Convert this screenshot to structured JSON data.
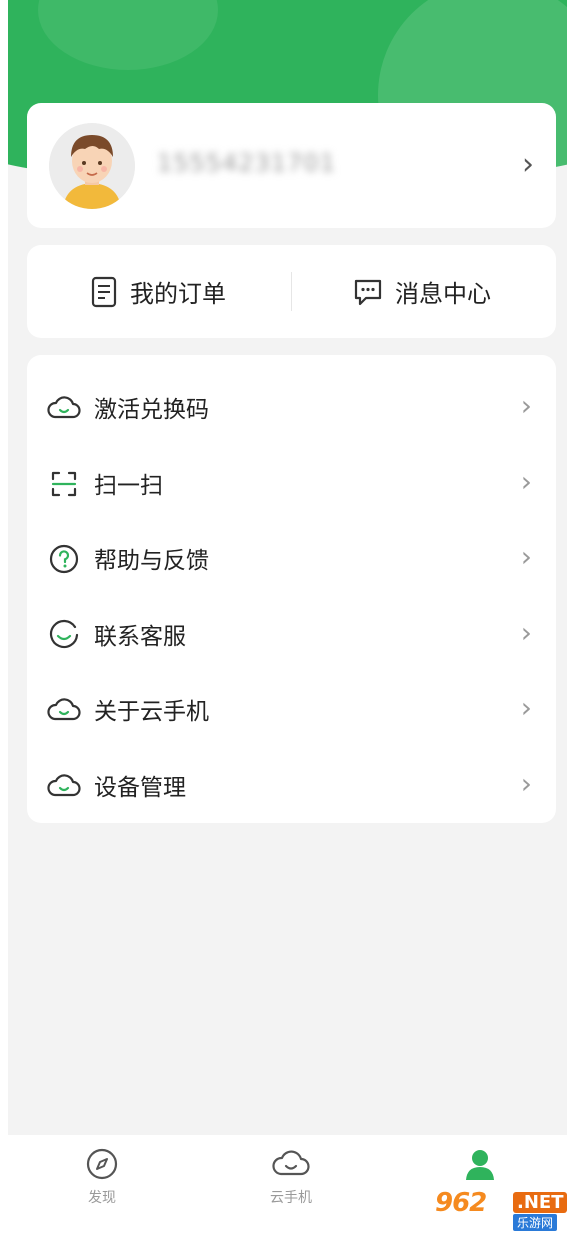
{
  "profile": {
    "phone": "15554231701",
    "avatar_icon": "avatar-boy-icon"
  },
  "quick_actions": [
    {
      "label": "我的订单",
      "icon": "order-list-icon"
    },
    {
      "label": "消息中心",
      "icon": "message-bubble-icon"
    }
  ],
  "menu": [
    {
      "label": "激活兑换码",
      "icon": "cloud-icon"
    },
    {
      "label": "扫一扫",
      "icon": "scan-icon"
    },
    {
      "label": "帮助与反馈",
      "icon": "help-icon"
    },
    {
      "label": "联系客服",
      "icon": "customer-service-icon"
    },
    {
      "label": "关于云手机",
      "icon": "cloud-icon"
    },
    {
      "label": "设备管理",
      "icon": "cloud-icon"
    }
  ],
  "bottom_nav": [
    {
      "label": "发现",
      "icon": "compass-icon",
      "active": false
    },
    {
      "label": "云手机",
      "icon": "cloud-icon",
      "active": false
    },
    {
      "label": "",
      "icon": "user-icon",
      "active": true
    }
  ],
  "watermark": {
    "brand": "962",
    "net": ".NET",
    "sub": "乐游网"
  },
  "colors": {
    "accent": "#2fb35c",
    "background": "#f3f3f3",
    "card": "#ffffff",
    "text": "#222222",
    "muted": "#9a9a9a"
  }
}
